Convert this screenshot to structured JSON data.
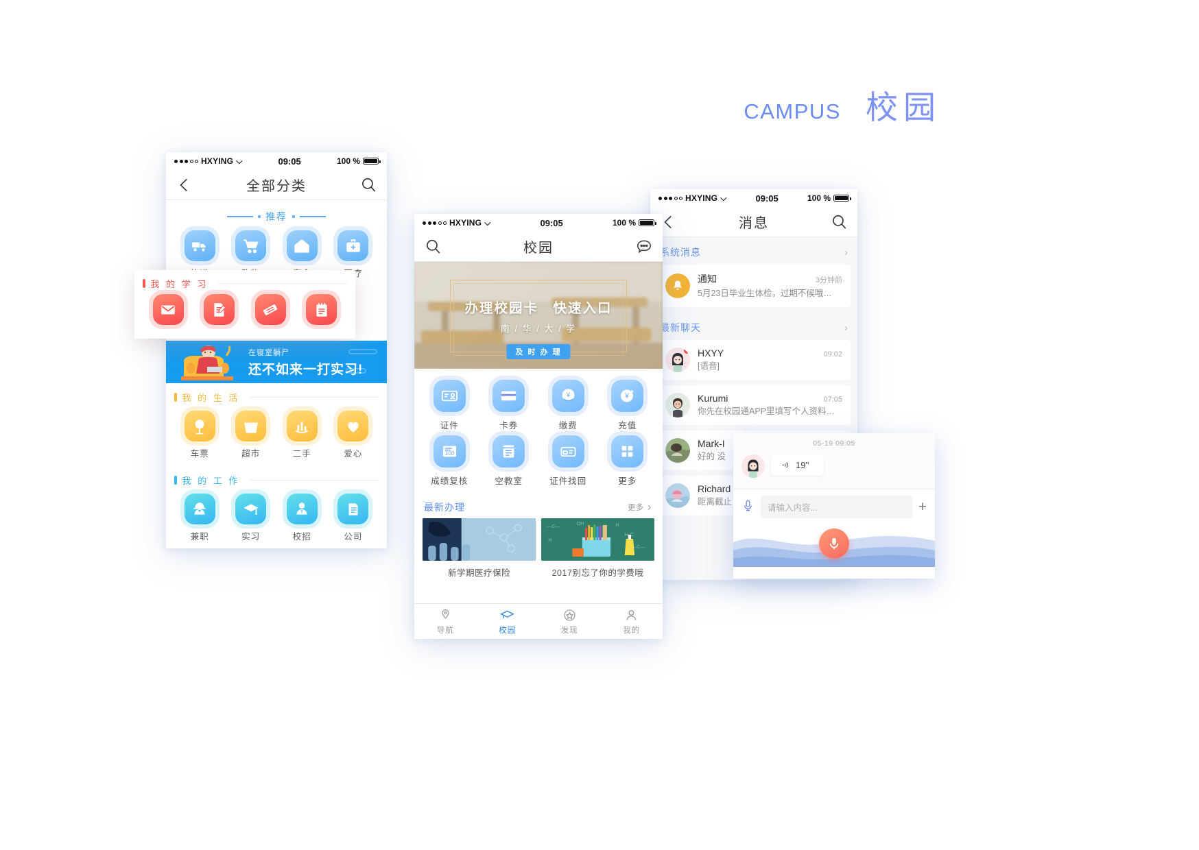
{
  "brand": {
    "en": "CAMPUS",
    "cn": "校园",
    "accent": "#6b8cf7"
  },
  "status_bar": {
    "carrier": "HXYING",
    "time": "09:05",
    "battery": "100 %"
  },
  "phone_categories": {
    "nav": {
      "title": "全部分类",
      "back_icon": "chevron-left-icon",
      "search_icon": "search-icon"
    },
    "recommend_label": "推荐",
    "recommend_items": [
      {
        "label": "快递",
        "icon": "delivery-truck-icon"
      },
      {
        "label": "购物",
        "icon": "shopping-cart-icon"
      },
      {
        "label": "宿舍",
        "icon": "dormitory-house-icon"
      },
      {
        "label": "医疗",
        "icon": "medical-kit-icon"
      }
    ],
    "banner": {
      "small": "在寝室躺尸",
      "big": "还不如来一打实习!",
      "bg": "#169bee"
    },
    "life_section": {
      "label": "我 的 生 活",
      "color": "#f6b83f"
    },
    "life_items": [
      {
        "label": "车票",
        "icon": "ticket-tree-icon"
      },
      {
        "label": "超市",
        "icon": "basket-icon"
      },
      {
        "label": "二手",
        "icon": "chart-bars-icon"
      },
      {
        "label": "爱心",
        "icon": "heart-icon"
      }
    ],
    "work_section": {
      "label": "我 的 工 作",
      "color": "#36b7ef"
    },
    "work_items": [
      {
        "label": "兼职",
        "icon": "worker-cap-icon"
      },
      {
        "label": "实习",
        "icon": "graduation-cap-icon"
      },
      {
        "label": "校招",
        "icon": "person-tie-icon"
      },
      {
        "label": "公司",
        "icon": "company-building-icon"
      }
    ]
  },
  "study_card": {
    "section": {
      "label": "我 的 学 习",
      "color": "#f2584f"
    },
    "items": [
      {
        "icon": "mail-envelope-icon"
      },
      {
        "icon": "document-edit-icon"
      },
      {
        "icon": "coupon-ticket-icon"
      },
      {
        "icon": "notepad-icon"
      }
    ]
  },
  "phone_campus": {
    "nav": {
      "title": "校园",
      "search_icon": "search-icon",
      "chat_icon": "chat-bubble-icon"
    },
    "hero": {
      "title": "办理校园卡　快速入口",
      "subtitle": "南 / 华 / 大 / 学",
      "button": "及 时 办 理"
    },
    "grid": [
      {
        "label": "证件",
        "icon": "id-card-icon"
      },
      {
        "label": "卡券",
        "icon": "bank-card-icon"
      },
      {
        "label": "缴费",
        "icon": "pay-hand-yuan-icon"
      },
      {
        "label": "充值",
        "icon": "recharge-yuan-plus-icon"
      },
      {
        "label": "成绩复核",
        "icon": "score-100-icon"
      },
      {
        "label": "空教室",
        "icon": "classroom-list-icon"
      },
      {
        "label": "证件找回",
        "icon": "card-retrieve-icon"
      },
      {
        "label": "更多",
        "icon": "grid-more-icon"
      }
    ],
    "latest": {
      "title": "最新办理",
      "more": "更多"
    },
    "cards": [
      {
        "title": "新学期医疗保险",
        "thumb": "lab-test-tubes-image"
      },
      {
        "title": "2017别忘了你的学费哦",
        "thumb": "blackboard-pencils-image"
      }
    ],
    "tabs": [
      {
        "label": "导航",
        "icon": "map-pin-icon",
        "active": false
      },
      {
        "label": "校园",
        "icon": "graduation-cap-icon",
        "active": true
      },
      {
        "label": "发现",
        "icon": "star-circle-icon",
        "active": false
      },
      {
        "label": "我的",
        "icon": "person-icon",
        "active": false
      }
    ]
  },
  "phone_messages": {
    "nav": {
      "title": "消息",
      "back_icon": "chevron-left-icon",
      "search_icon": "search-icon"
    },
    "system_section": "系统消息",
    "system_rows": [
      {
        "name": "通知",
        "time": "3分钟前",
        "preview": "5月23日毕业生体检，过期不候哦…",
        "avatar": "bell-icon"
      }
    ],
    "chat_section": "最新聊天",
    "chat_rows": [
      {
        "name": "HXYY",
        "time": "09:02",
        "preview": "[语音]",
        "avatar": "avatar-female-1",
        "unread": true
      },
      {
        "name": "Kurumi",
        "time": "07:05",
        "preview": "你先在校园通APP里填写个人资料…",
        "avatar": "avatar-male-1",
        "unread": false
      },
      {
        "name": "Mark-I",
        "time": "",
        "preview": "好的  没",
        "avatar": "avatar-photo-1",
        "unread": false
      },
      {
        "name": "Richard",
        "time": "",
        "preview": "距离截止",
        "avatar": "avatar-photo-2",
        "unread": false
      }
    ]
  },
  "chat_overlay": {
    "timestamp": "05-19 09:05",
    "voice_message": {
      "duration": "19''",
      "icon": "voice-wave-icon",
      "avatar": "avatar-female-1"
    },
    "input_placeholder": "请输入内容...",
    "mic_icon": "microphone-icon",
    "plus_icon": "plus-icon",
    "record_button_icon": "microphone-icon"
  }
}
